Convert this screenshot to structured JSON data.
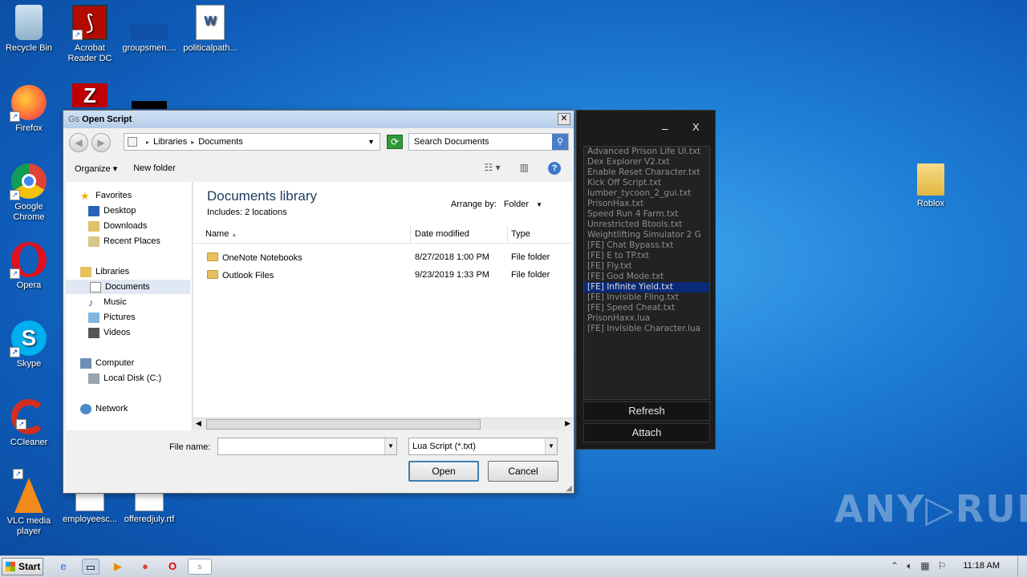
{
  "desktop": {
    "icons": [
      {
        "label": "Recycle Bin"
      },
      {
        "label": "Acrobat Reader DC"
      },
      {
        "label": "groupsmen...."
      },
      {
        "label": "politicalpath..."
      },
      {
        "label": "Firefox"
      },
      {
        "label": "Google Chrome"
      },
      {
        "label": "Opera"
      },
      {
        "label": "Skype"
      },
      {
        "label": "CCleaner"
      },
      {
        "label": "VLC media player"
      },
      {
        "label": "employeesc..."
      },
      {
        "label": "offeredjuly.rtf"
      },
      {
        "label": "Roblox"
      }
    ]
  },
  "dialog": {
    "title_prefix": "Gs",
    "title": "Open Script",
    "close": "✕",
    "breadcrumb": [
      "Libraries",
      "Documents"
    ],
    "search_placeholder": "Search Documents",
    "cmd": {
      "organize": "Organize ▾",
      "new_folder": "New folder"
    },
    "nav": {
      "favorites": "Favorites",
      "desktop": "Desktop",
      "downloads": "Downloads",
      "recent": "Recent Places",
      "libraries": "Libraries",
      "documents": "Documents",
      "music": "Music",
      "pictures": "Pictures",
      "videos": "Videos",
      "computer": "Computer",
      "localdisk": "Local Disk (C:)",
      "network": "Network"
    },
    "library_title": "Documents library",
    "library_sub": "Includes:  2 locations",
    "arrange_label": "Arrange by:",
    "arrange_value": "Folder",
    "columns": {
      "name": "Name",
      "date": "Date modified",
      "type": "Type"
    },
    "files": [
      {
        "name": "OneNote Notebooks",
        "date": "8/27/2018 1:00 PM",
        "type": "File folder"
      },
      {
        "name": "Outlook Files",
        "date": "9/23/2019 1:33 PM",
        "type": "File folder"
      }
    ],
    "filename_label": "File name:",
    "filename_value": "",
    "filetype_value": "Lua Script (*.txt)",
    "open_label": "Open",
    "cancel_label": "Cancel"
  },
  "executor": {
    "minimize": "–",
    "close": "X",
    "scripts": [
      "Advanced Prison Life UI.txt",
      "Dex Explorer V2.txt",
      "Enable Reset Character.txt",
      "Kick Off Script.txt",
      "lumber_tycoon_2_gui.txt",
      "PrisonHax.txt",
      "Speed Run 4 Farm.txt",
      "Unrestricted Btools.txt",
      "Weightlifting Simulator 2 G",
      "[FE] Chat Bypass.txt",
      "[FE] E to TP.txt",
      "[FE] Fly.txt",
      "[FE] God Mode.txt",
      "[FE] Infinite Yield.txt",
      "[FE] Invisible Fling.txt",
      "[FE] Speed Cheat.txt",
      "PrisonHaxx.lua",
      "[FE] Invisible Character.lua"
    ],
    "selected_index": 13,
    "refresh_label": "Refresh",
    "attach_label": "Attach"
  },
  "watermark": "ANY▷RUN",
  "taskbar": {
    "start_label": "Start",
    "clock": "11:18 AM"
  }
}
